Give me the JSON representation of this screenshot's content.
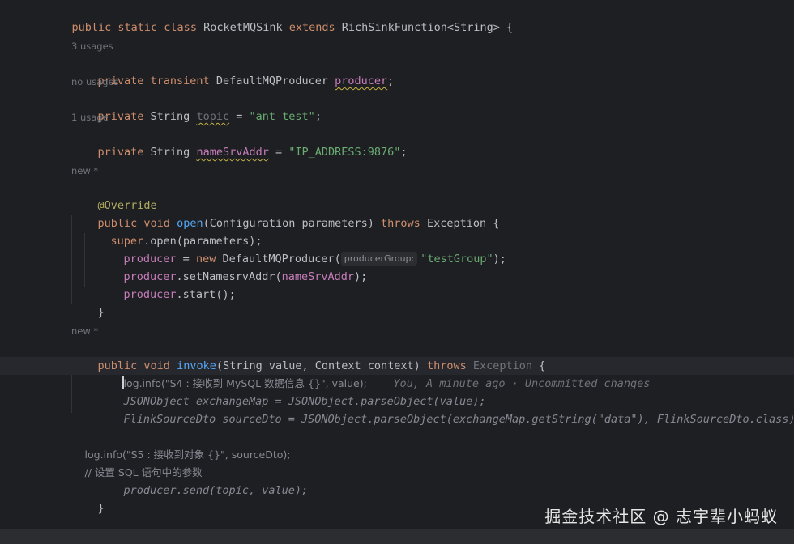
{
  "code": {
    "l01": {
      "kw1": "public static class ",
      "name": "RocketMQSink ",
      "kw2": "extends ",
      "rest": "RichSinkFunction<String> {"
    },
    "hint_3usages": "3 usages",
    "l02": {
      "kw": "private transient ",
      "type": "DefaultMQProducer ",
      "field": "producer",
      "semi": ";"
    },
    "hint_nousages": "no usages",
    "l03": {
      "kw": "private ",
      "type": "String ",
      "field": "topic",
      "eq": " = ",
      "str": "\"ant-test\"",
      "semi": ";"
    },
    "hint_1usage": "1 usage",
    "l04": {
      "kw": "private ",
      "type": "String ",
      "field": "nameSrvAddr",
      "eq": " = ",
      "str": "\"IP_ADDRESS:9876\"",
      "semi": ";"
    },
    "hint_new1": "new *",
    "l05": {
      "anno": "@Override"
    },
    "l06": {
      "kw": "public void ",
      "fn": "open",
      "args": "(Configuration parameters) ",
      "throws": "throws ",
      "rest": "Exception {"
    },
    "l07": {
      "kw": "super",
      "rest": ".open(parameters);"
    },
    "l08": {
      "field": "producer",
      "eq": " = ",
      "kw": "new ",
      "rest": "DefaultMQProducer(",
      "hint": "producerGroup:",
      "str": "\"testGroup\"",
      "end": ");"
    },
    "l09": {
      "field": "producer",
      "mid": ".setNamesrvAddr(",
      "field2": "nameSrvAddr",
      "end": ");"
    },
    "l10": {
      "field": "producer",
      "end": ".start();"
    },
    "l11": {
      "brace": "}"
    },
    "hint_new2": "new *",
    "l12": {
      "kw": "public void ",
      "fn": "invoke",
      "args": "(String value, Context context) ",
      "throws": "throws ",
      "exc": "Exception",
      "rest": " {"
    },
    "l13": {
      "text": "log.info(\"S4 : 接收到 MySQL 数据信息 {}\", value);",
      "blame": "You, A minute ago · Uncommitted changes"
    },
    "l14": {
      "text": "JSONObject exchangeMap = JSONObject.parseObject(value);"
    },
    "l15": {
      "text": "FlinkSourceDto sourceDto = JSONObject.parseObject(exchangeMap.getString(\"data\"), FlinkSourceDto.class);"
    },
    "l16": {
      "text": "log.info(\"S5 : 接收到对象 {}\", sourceDto);"
    },
    "l17": {
      "text": "// 设置 SQL 语句中的参数"
    },
    "l18": {
      "text": "producer.send(topic, value);"
    },
    "l19": {
      "brace": "}"
    },
    "l20": {
      "brace": "}"
    }
  },
  "watermark": "掘金技术社区 @ 志宇辈小蚂蚁"
}
